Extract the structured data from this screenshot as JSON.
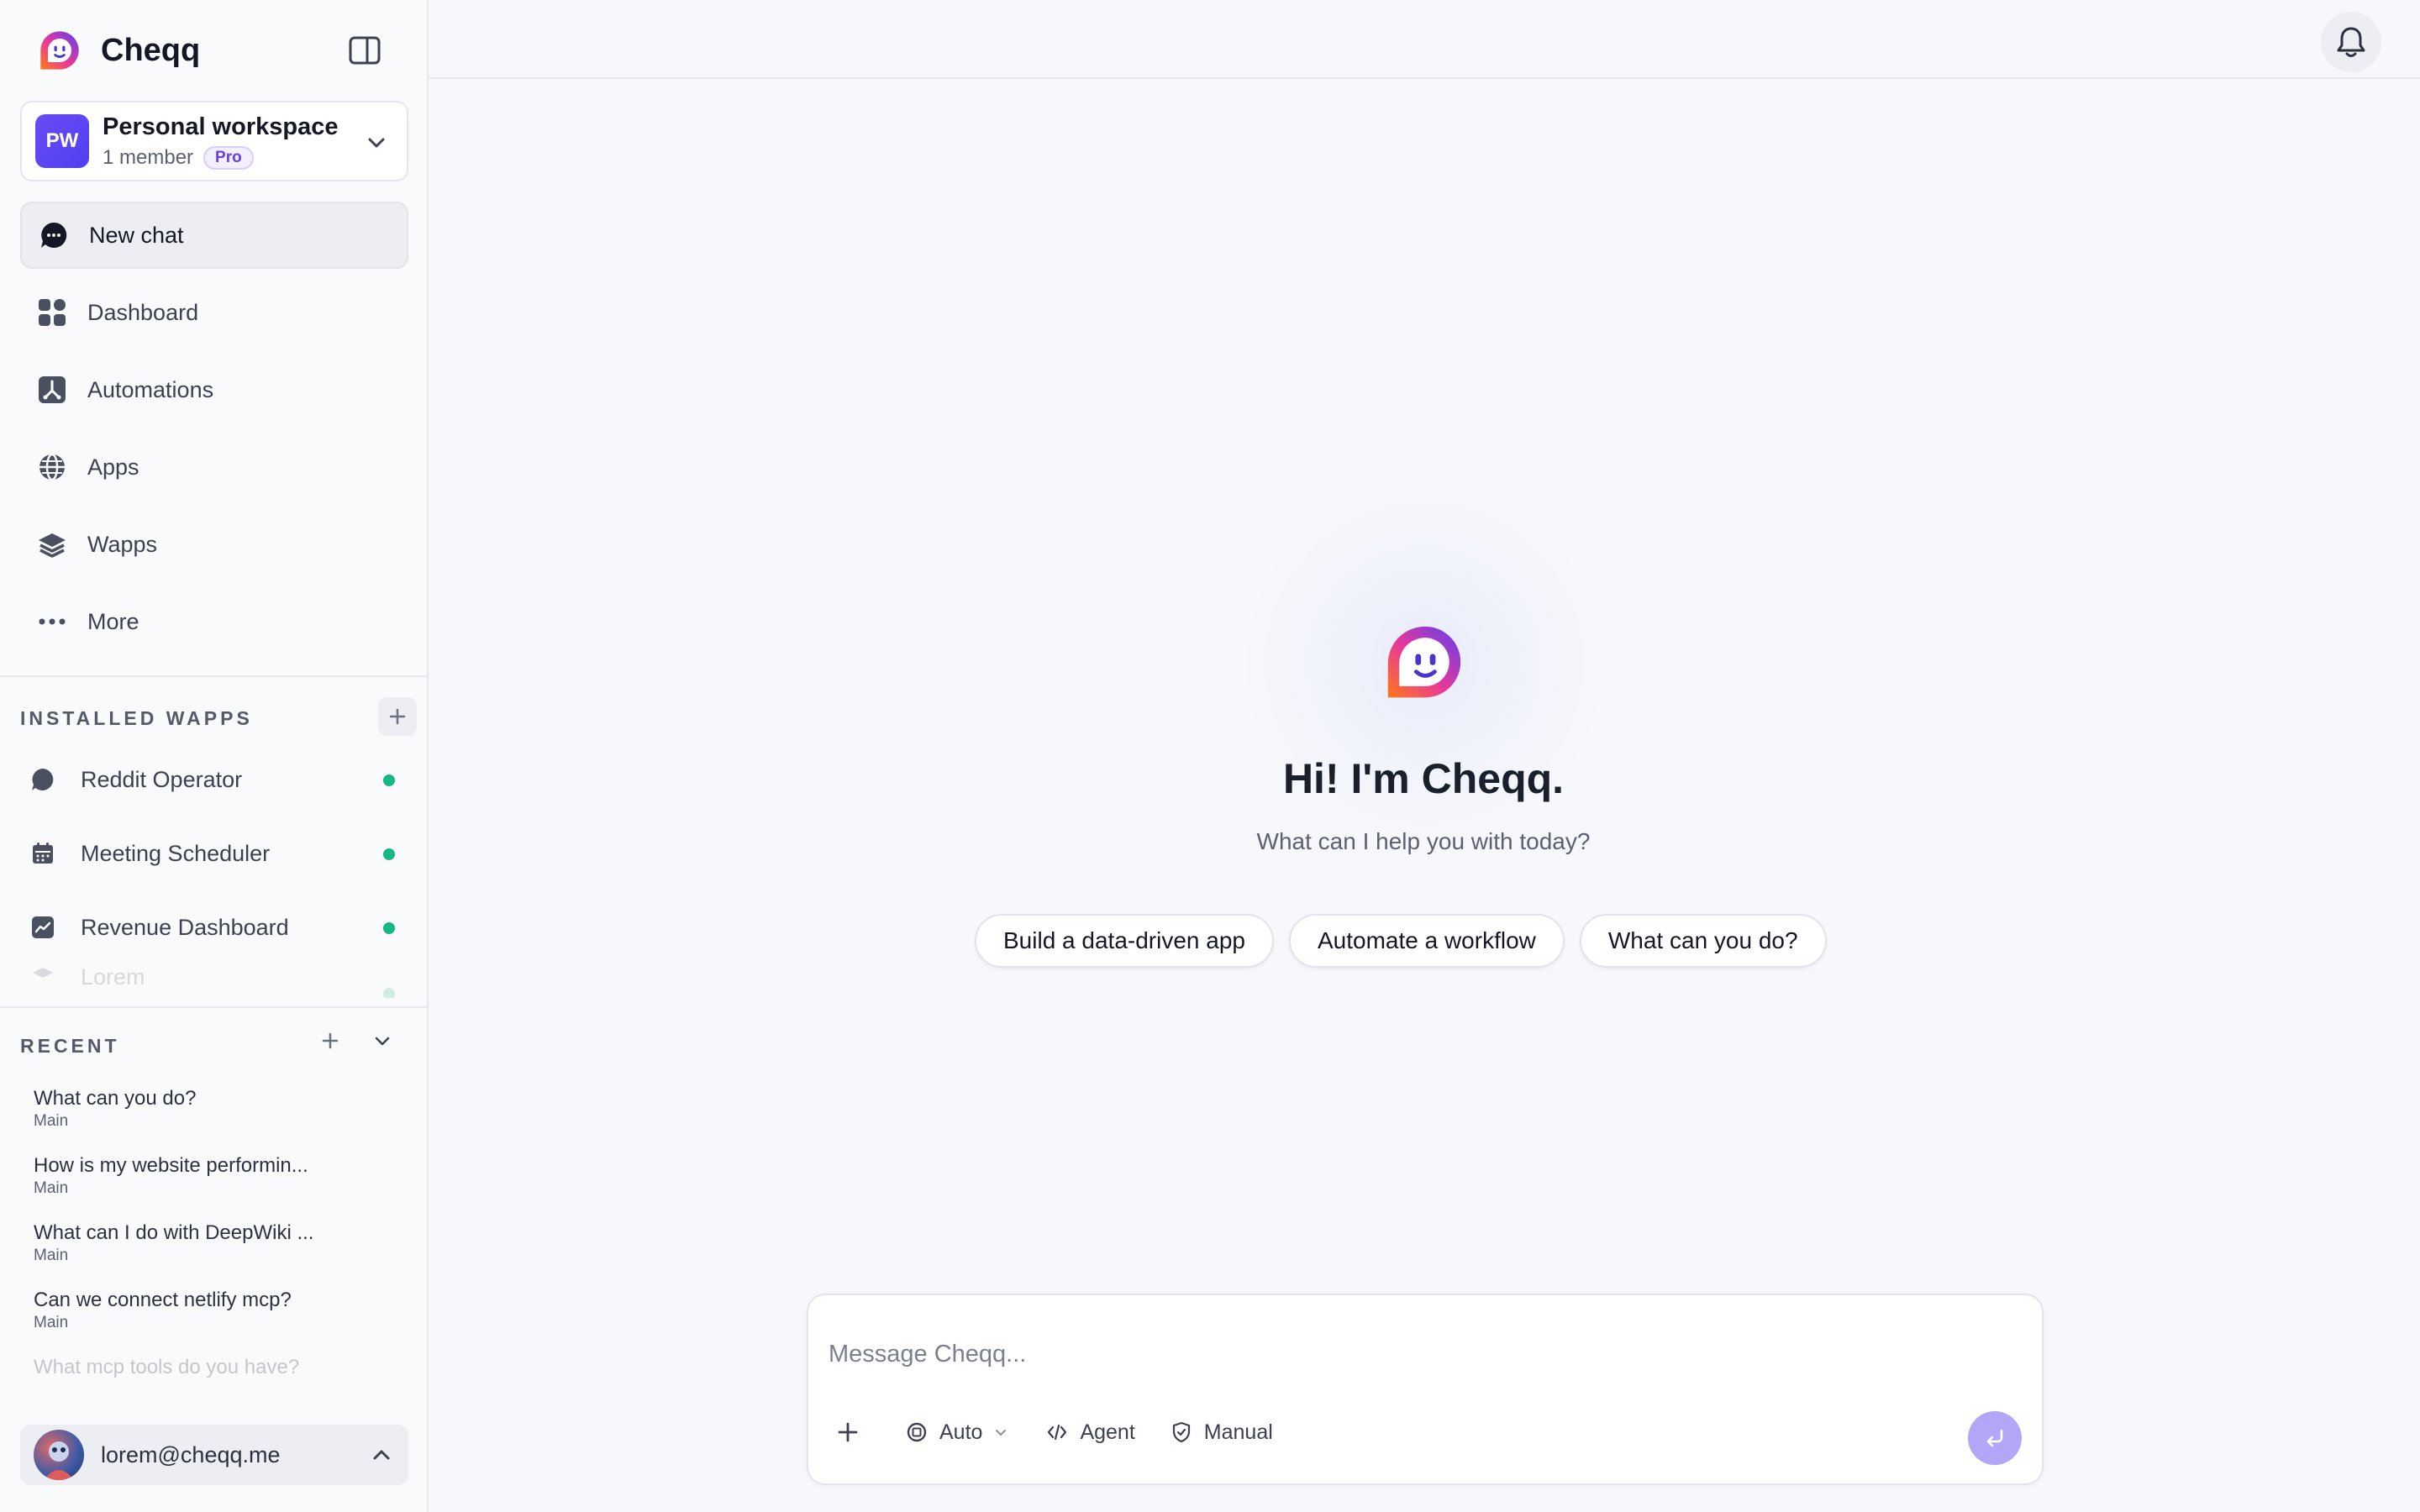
{
  "app": {
    "name": "Cheqq"
  },
  "workspace": {
    "initials": "PW",
    "name": "Personal workspace",
    "members": "1 member",
    "plan": "Pro"
  },
  "nav": {
    "items": [
      {
        "label": "New chat",
        "icon": "chat-bubble-icon",
        "active": true
      },
      {
        "label": "Dashboard",
        "icon": "grid-icon"
      },
      {
        "label": "Automations",
        "icon": "automation-icon"
      },
      {
        "label": "Apps",
        "icon": "globe-icon"
      },
      {
        "label": "Wapps",
        "icon": "layers-icon"
      },
      {
        "label": "More",
        "icon": "more-dots-icon"
      }
    ]
  },
  "installed_wapps": {
    "title": "INSTALLED WAPPS",
    "items": [
      {
        "label": "Reddit Operator",
        "icon": "chat-bubble-icon",
        "status_color": "#16b882"
      },
      {
        "label": "Meeting Scheduler",
        "icon": "calendar-icon",
        "status_color": "#16b882"
      },
      {
        "label": "Revenue Dashboard",
        "icon": "chart-icon",
        "status_color": "#16b882"
      },
      {
        "label": "Lorem",
        "icon": "layers-icon",
        "status_color": "#16b882"
      }
    ]
  },
  "recent": {
    "title": "RECENT",
    "items": [
      {
        "title": "What can you do?",
        "sub": "Main"
      },
      {
        "title": "How is my website performin...",
        "sub": "Main"
      },
      {
        "title": "What can I do with DeepWiki ...",
        "sub": "Main"
      },
      {
        "title": "Can we connect netlify mcp?",
        "sub": "Main"
      },
      {
        "title": "What mcp tools do you have?",
        "sub": ""
      }
    ]
  },
  "user": {
    "email": "lorem@cheqq.me"
  },
  "hero": {
    "greeting": "Hi! I'm Cheqq.",
    "subtitle": "What can I help you with today?",
    "suggestions": [
      "Build a data-driven app",
      "Automate a workflow",
      "What can you do?"
    ]
  },
  "composer": {
    "placeholder": "Message Cheqq...",
    "model": "Auto",
    "mode_agent": "Agent",
    "mode_manual": "Manual"
  },
  "colors": {
    "accent": "#6a4cf5",
    "status_green": "#16b882",
    "send_button": "#b3a6f7"
  }
}
